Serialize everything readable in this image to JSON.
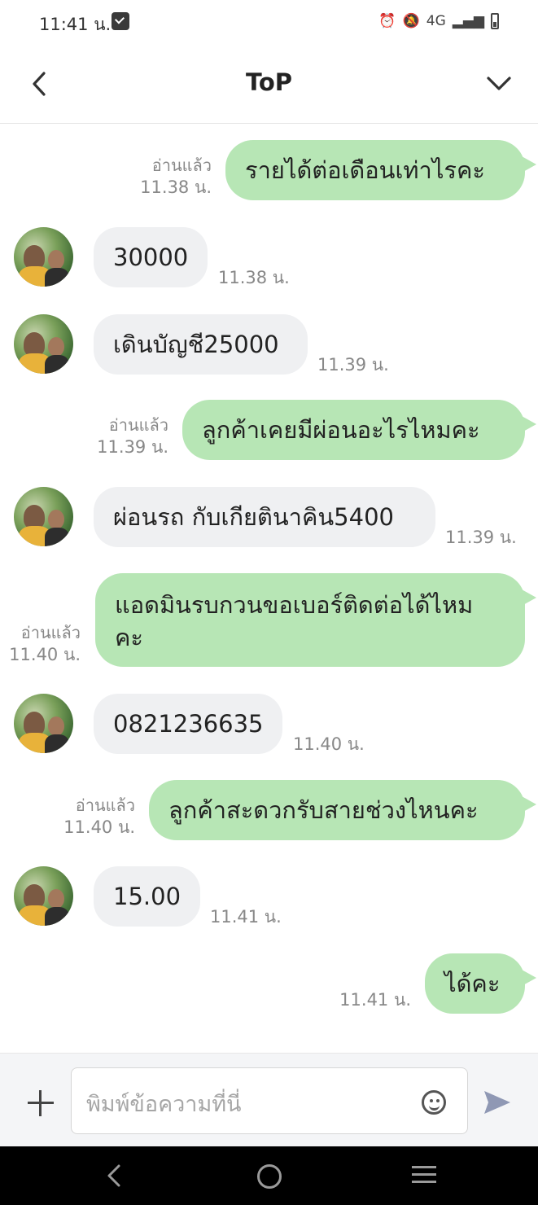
{
  "status_bar": {
    "time": "11:41 น.",
    "network": "4G"
  },
  "header": {
    "title": "ToP"
  },
  "messages": [
    {
      "direction": "out",
      "text": "รายได้ต่อเดือนเท่าไรคะ",
      "read": "อ่านแล้ว",
      "time": "11.38 น."
    },
    {
      "direction": "in",
      "text": "30000",
      "time": "11.38 น."
    },
    {
      "direction": "in",
      "text": "เดินบัญชี25000",
      "time": "11.39 น."
    },
    {
      "direction": "out",
      "text": "ลูกค้าเคยมีผ่อนอะไรไหมคะ",
      "read": "อ่านแล้ว",
      "time": "11.39 น."
    },
    {
      "direction": "in",
      "text": "ผ่อนรถ กับเกียตินาคิน5400",
      "time": "11.39 น."
    },
    {
      "direction": "out",
      "text_line1": "แอดมินรบกวนขอเบอร์ติดต่อได้ไหม",
      "text_line2": "คะ",
      "read": "อ่านแล้ว",
      "time": "11.40 น."
    },
    {
      "direction": "in",
      "text": "0821236635",
      "time": "11.40 น."
    },
    {
      "direction": "out",
      "text": "ลูกค้าสะดวกรับสายช่วงไหนคะ",
      "read": "อ่านแล้ว",
      "time": "11.40 น."
    },
    {
      "direction": "in",
      "text": "15.00",
      "time": "11.41 น."
    },
    {
      "direction": "out",
      "text": "ได้คะ",
      "time": "11.41 น."
    }
  ],
  "input": {
    "placeholder": "พิมพ์ข้อความที่นี่"
  },
  "colors": {
    "outgoing_bubble": "#b7e6b5",
    "incoming_bubble": "#eff0f2",
    "send_icon": "#8f98b4"
  }
}
